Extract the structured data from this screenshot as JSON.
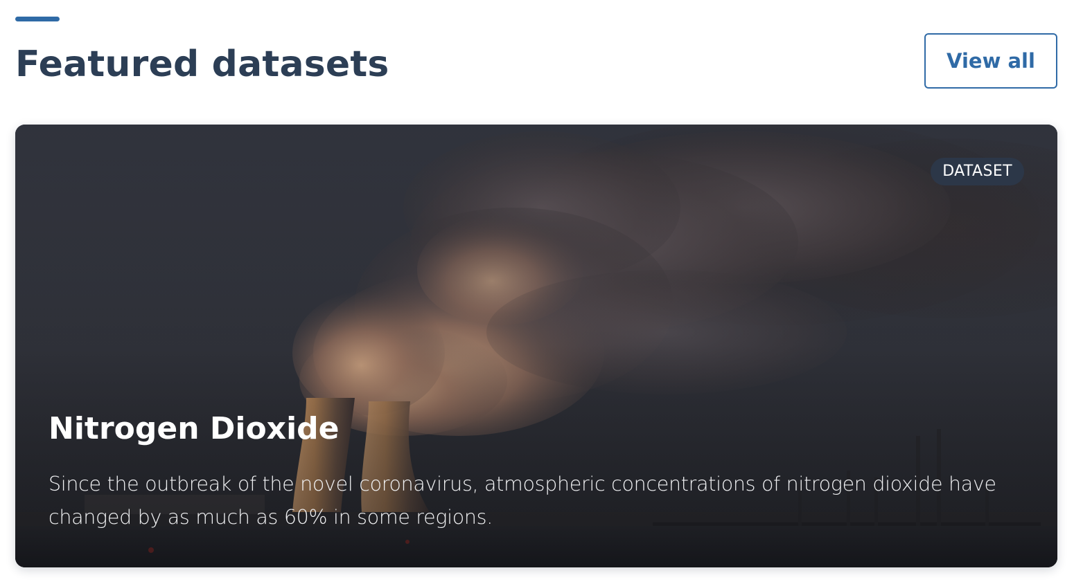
{
  "section": {
    "title": "Featured datasets",
    "view_all_label": "View all"
  },
  "featured_card": {
    "badge": "DATASET",
    "title": "Nitrogen Dioxide",
    "description": "Since the outbreak of the novel coronavirus, atmospheric concentrations of nitrogen dioxide have changed by as much as 60% in some regions.",
    "image": "power-plant-cooling-towers-smoke-photo"
  },
  "colors": {
    "accent": "#2f6aa6",
    "heading": "#2c3e55",
    "badge_bg": "#2c384a"
  }
}
